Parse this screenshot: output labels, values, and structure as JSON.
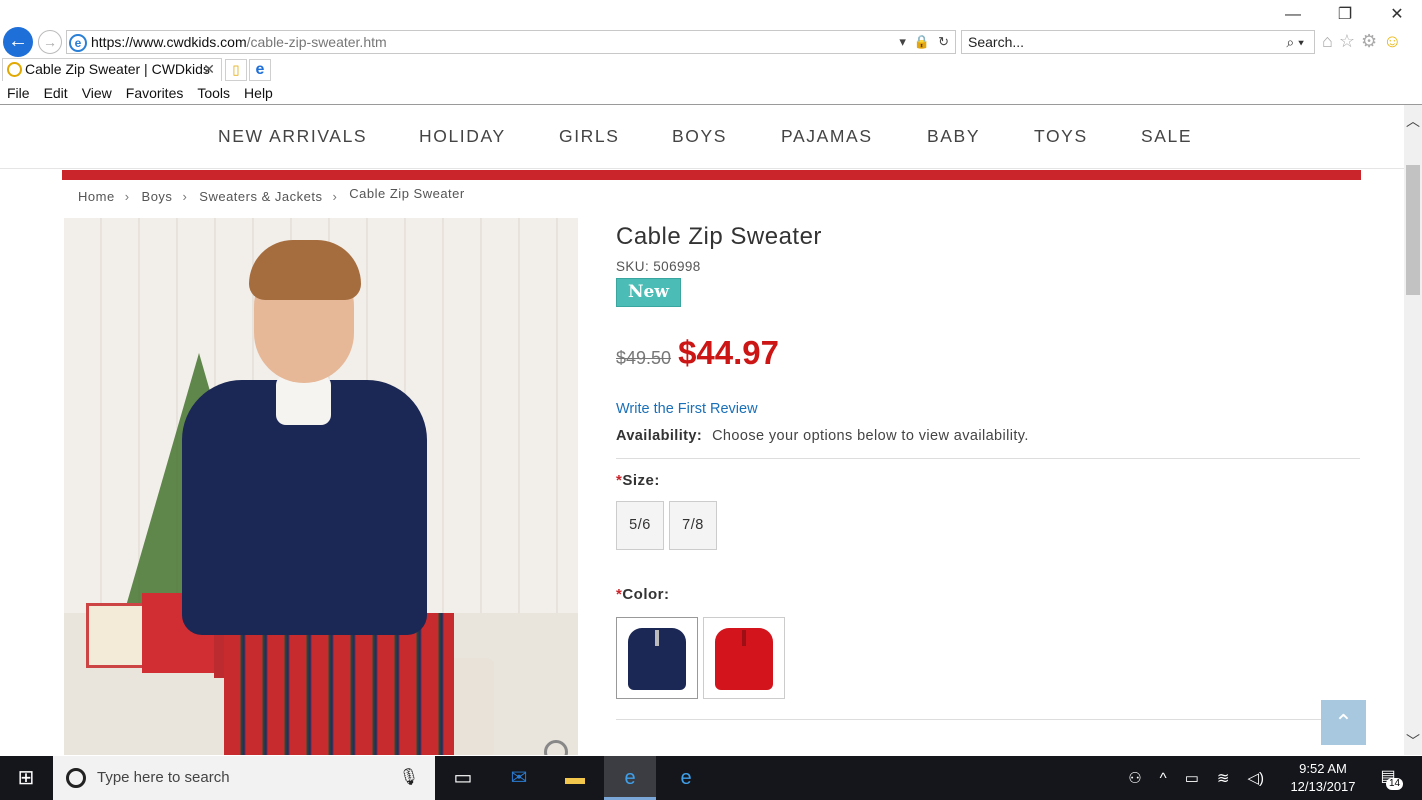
{
  "browser": {
    "url_host": "https://www.cwdkids.com",
    "url_path": "/cable-zip-sweater.htm",
    "search_placeholder": "Search...",
    "tab_title": "Cable Zip Sweater | CWDkids",
    "menu": [
      "File",
      "Edit",
      "View",
      "Favorites",
      "Tools",
      "Help"
    ]
  },
  "nav": {
    "items": [
      "NEW ARRIVALS",
      "HOLIDAY",
      "GIRLS",
      "BOYS",
      "PAJAMAS",
      "BABY",
      "TOYS",
      "SALE"
    ]
  },
  "breadcrumb": [
    "Home",
    "Boys",
    "Sweaters & Jackets",
    "Cable Zip Sweater"
  ],
  "product": {
    "title": "Cable Zip Sweater",
    "sku": "SKU: 506998",
    "badge": "New",
    "old_price": "$49.50",
    "price": "$44.97",
    "review_link": "Write the First Review",
    "availability_label": "Availability:",
    "availability_text": "Choose your options below to view availability.",
    "size_label": "Size:",
    "sizes": [
      "5/6",
      "7/8"
    ],
    "color_label": "Color:",
    "colors": [
      {
        "name": "navy",
        "hex": "#1b2754"
      },
      {
        "name": "red",
        "hex": "#d3141c"
      }
    ]
  },
  "taskbar": {
    "search_placeholder": "Type here to search",
    "time": "9:52 AM",
    "date": "12/13/2017",
    "notifications": "14"
  },
  "colors": {
    "accent_red": "#c9252b",
    "price_red": "#cc1515",
    "badge_teal": "#4cbdb6",
    "link_blue": "#1a70b8"
  }
}
